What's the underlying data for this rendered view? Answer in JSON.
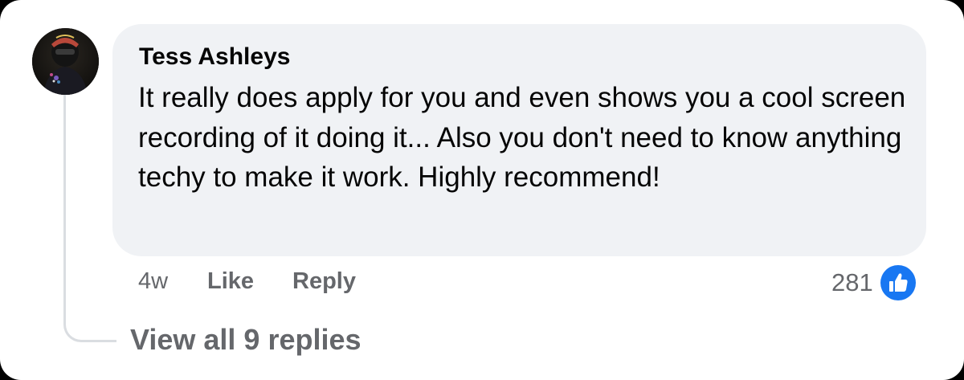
{
  "comment": {
    "author": "Tess Ashleys",
    "text": "It really does apply for you and even shows you a cool screen recording of it doing it... Also you don't need to know anything techy to make it work. Highly recommend!",
    "avatar_icon": "profile-photo",
    "timestamp": "4w",
    "like_label": "Like",
    "reply_label": "Reply",
    "reaction_count": "281",
    "reaction_icon": "like-thumbs-up-icon"
  },
  "replies": {
    "view_all_label": "View all 9 replies"
  },
  "colors": {
    "bubble_bg": "#f0f2f5",
    "text": "#050505",
    "secondary_text": "#65676b",
    "like_blue": "#1877f2",
    "thread_line": "#dadde1"
  }
}
